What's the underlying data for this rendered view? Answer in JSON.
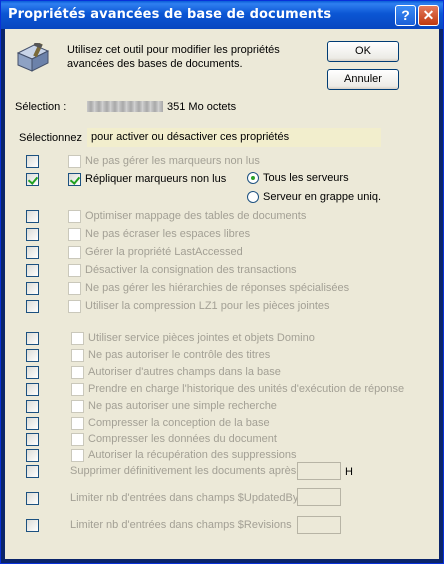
{
  "window": {
    "title": "Propriétés avancées de base de documents"
  },
  "header": {
    "description_line1": "Utilisez cet outil pour modifier les propriétés",
    "description_line2": "avancées des bases de documents.",
    "ok_label": "OK",
    "cancel_label": "Annuler"
  },
  "selection": {
    "label": "Sélection :",
    "size": "351 Mo octets"
  },
  "toggle_row": {
    "label": "Sélectionnez",
    "hint": "pour activer ou désactiver ces propriétés"
  },
  "replicate_options": {
    "all_servers": "Tous les serveurs",
    "cluster": "Serveur en grappe uniq."
  },
  "props": [
    {
      "label": "Ne pas gérer les marqueurs non lus"
    },
    {
      "label": "Répliquer marqueurs non lus"
    },
    {
      "label": "Optimiser mappage des tables de documents"
    },
    {
      "label": "Ne pas écraser les espaces libres"
    },
    {
      "label": "Gérer la propriété LastAccessed"
    },
    {
      "label": "Désactiver la consignation des transactions"
    },
    {
      "label": "Ne pas gérer les hiérarchies de réponses spécialisées"
    },
    {
      "label": "Utiliser la compression LZ1 pour les pièces jointes"
    },
    {
      "label": "Utiliser service pièces jointes et objets Domino"
    },
    {
      "label": "Ne pas autoriser le contrôle des titres"
    },
    {
      "label": "Autoriser d'autres champs dans la base"
    },
    {
      "label": "Prendre en charge l'historique des unités d'exécution de réponse"
    },
    {
      "label": "Ne pas autoriser une simple recherche"
    },
    {
      "label": "Compresser la conception de la base"
    },
    {
      "label": "Compresser les données du document"
    },
    {
      "label": "Autoriser la récupération des suppressions"
    },
    {
      "label": "Supprimer définitivement les documents après",
      "unit": "H"
    },
    {
      "label": "Limiter nb d'entrées dans champs $UpdatedBy"
    },
    {
      "label": "Limiter nb d'entrées dans champs $Revisions"
    }
  ]
}
